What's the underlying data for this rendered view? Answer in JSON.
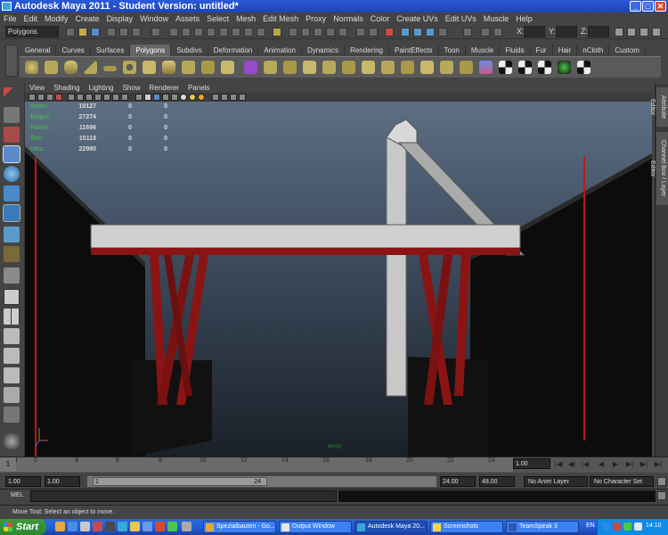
{
  "window": {
    "title": "Autodesk Maya 2011 - Student Version: untitled*",
    "minimize": "_",
    "maximize": "□",
    "close": "✕"
  },
  "menu": [
    "File",
    "Edit",
    "Modify",
    "Create",
    "Display",
    "Window",
    "Assets",
    "Select",
    "Mesh",
    "Edit Mesh",
    "Proxy",
    "Normals",
    "Color",
    "Create UVs",
    "Edit UVs",
    "Muscle",
    "Help"
  ],
  "status_line": {
    "mode": "Polygons",
    "coord_labels": [
      "X:",
      "Y:",
      "Z:"
    ]
  },
  "shelf": {
    "tabs": [
      "General",
      "Curves",
      "Surfaces",
      "Polygons",
      "Subdivs",
      "Deformation",
      "Animation",
      "Dynamics",
      "Rendering",
      "PaintEffects",
      "Toon",
      "Muscle",
      "Fluids",
      "Fur",
      "Hair",
      "nCloth",
      "Custom"
    ],
    "active_tab": "Polygons"
  },
  "panel": {
    "menu": [
      "View",
      "Shading",
      "Lighting",
      "Show",
      "Renderer",
      "Panels"
    ],
    "camera_label": "persp"
  },
  "hud": {
    "rows": [
      {
        "label": "Verts:",
        "values": [
          "19127",
          "0",
          "0"
        ]
      },
      {
        "label": "Edges:",
        "values": [
          "27274",
          "0",
          "0"
        ]
      },
      {
        "label": "Faces:",
        "values": [
          "11696",
          "0",
          "0"
        ]
      },
      {
        "label": "Tris:",
        "values": [
          "15118",
          "0",
          "0"
        ]
      },
      {
        "label": "UVs:",
        "values": [
          "22980",
          "0",
          "0"
        ]
      }
    ]
  },
  "side_tabs": [
    "Attribute Editor",
    "Channel Box / Layer Editor"
  ],
  "time_slider": {
    "current_frame": "1",
    "ticks": [
      "2",
      "4",
      "6",
      "8",
      "10",
      "12",
      "14",
      "16",
      "18",
      "20",
      "22",
      "24"
    ],
    "current_time_field": "1.00",
    "playback": [
      "|◀",
      "◀|",
      "◀",
      "▶",
      "▶|",
      "▶|"
    ]
  },
  "range_slider": {
    "start_time": "1.00",
    "playback_start": "1.00",
    "range_start_label": "1",
    "range_end_label": "24",
    "playback_end": "24.00",
    "end_time": "48.00",
    "anim_layer": "No Anim Layer",
    "character_set": "No Character Set"
  },
  "command_line": {
    "label": "MEL"
  },
  "help_line": "Move Tool: Select an object to move.",
  "taskbar": {
    "start": "Start",
    "tasks": [
      {
        "label": "Spezialbauten - Go...",
        "color": "#e8a83a"
      },
      {
        "label": "Output Window",
        "color": "#e8e8e8"
      },
      {
        "label": "Autodesk Maya 20...",
        "color": "#38a6d8"
      },
      {
        "label": "Screenshots",
        "color": "#f8d84a"
      },
      {
        "label": "TeamSpeak 3",
        "color": "#2a5ab8"
      }
    ],
    "language": "EN",
    "clock": "14:10"
  },
  "colors": {
    "maya_bg": "#444444",
    "viewport_sky_top": "#5d6f84",
    "beam_red": "#8a1414",
    "hud_green": "#4caf50",
    "taskbar_blue": "#245edb"
  }
}
